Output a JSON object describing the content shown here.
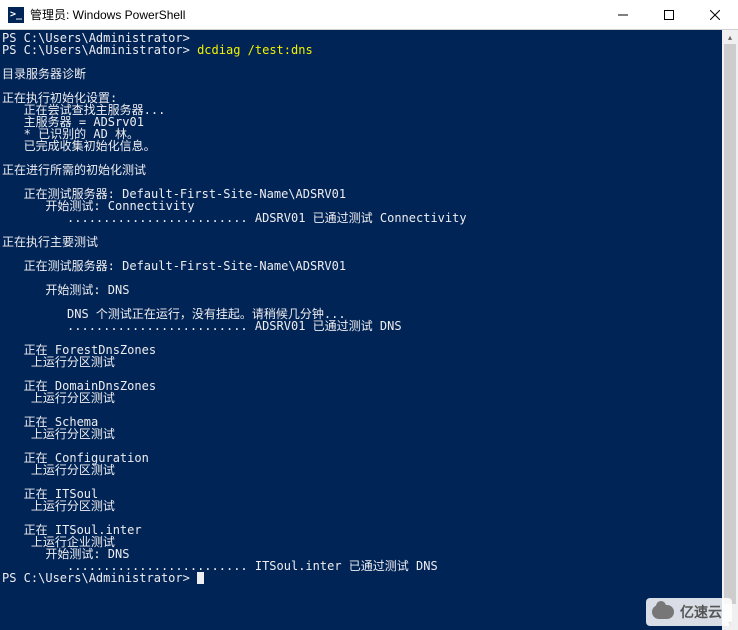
{
  "window": {
    "title": "管理员: Windows PowerShell",
    "icon_glyph": ">_"
  },
  "prompt_path": "PS C:\\Users\\Administrator>",
  "command": "dcdiag /test:dns",
  "output": {
    "l1": "目录服务器诊断",
    "l2": "正在执行初始化设置:",
    "l3": "   正在尝试查找主服务器...",
    "l4": "   主服务器 = ADSrv01",
    "l5": "   * 已识别的 AD 林。",
    "l6": "   已完成收集初始化信息。",
    "l7": "正在进行所需的初始化测试",
    "l8": "   正在测试服务器: Default-First-Site-Name\\ADSRV01",
    "l9": "      开始测试: Connectivity",
    "l10": "         ......................... ADSRV01 已通过测试 Connectivity",
    "l11": "正在执行主要测试",
    "l12": "   正在测试服务器: Default-First-Site-Name\\ADSRV01",
    "l13": "      开始测试: DNS",
    "l14": "         DNS 个测试正在运行，没有挂起。请稍候几分钟...",
    "l15": "         ......................... ADSRV01 已通过测试 DNS",
    "l16": "   正在 ForestDnsZones",
    "l17": "    上运行分区测试",
    "l18": "   正在 DomainDnsZones",
    "l19": "    上运行分区测试",
    "l20": "   正在 Schema",
    "l21": "    上运行分区测试",
    "l22": "   正在 Configuration",
    "l23": "    上运行分区测试",
    "l24": "   正在 ITSoul",
    "l25": "    上运行分区测试",
    "l26": "   正在 ITSoul.inter",
    "l27": "    上运行企业测试",
    "l28": "      开始测试: DNS",
    "l29": "         ......................... ITSoul.inter 已通过测试 DNS"
  },
  "watermark": "亿速云"
}
